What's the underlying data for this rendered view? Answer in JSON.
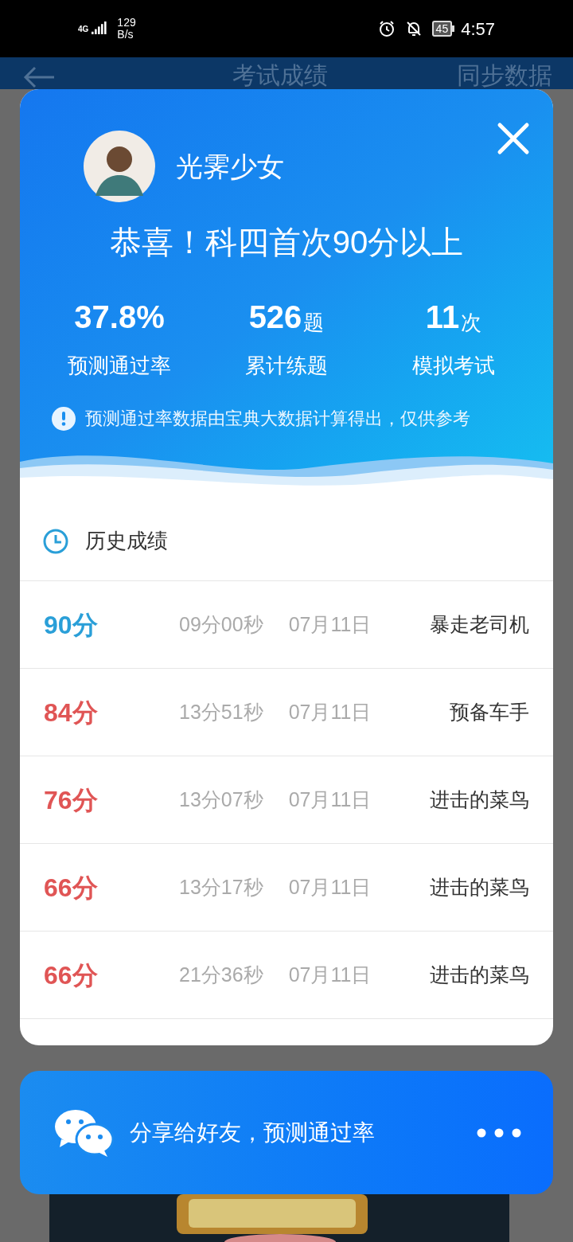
{
  "status_bar": {
    "network": "4G",
    "speed": "129",
    "speed_unit": "B/s",
    "battery": "45",
    "time": "4:57"
  },
  "page": {
    "title": "考试成绩",
    "action": "同步数据"
  },
  "result": {
    "user_name": "光霁少女",
    "headline": "恭喜！科四首次90分以上",
    "stats": [
      {
        "value": "37.8%",
        "label": "预测通过率"
      },
      {
        "value": "526",
        "unit": "题",
        "label": "累计练题"
      },
      {
        "value": "11",
        "unit": "次",
        "label": "模拟考试"
      }
    ],
    "notice": "预测通过率数据由宝典大数据计算得出，仅供参考"
  },
  "history": {
    "title": "历史成绩",
    "rows": [
      {
        "score": "90分",
        "color": "#2a9fd8",
        "duration": "09分00秒",
        "date": "07月11日",
        "rank": "暴走老司机"
      },
      {
        "score": "84分",
        "color": "#e05555",
        "duration": "13分51秒",
        "date": "07月11日",
        "rank": "预备车手"
      },
      {
        "score": "76分",
        "color": "#e05555",
        "duration": "13分07秒",
        "date": "07月11日",
        "rank": "进击的菜鸟"
      },
      {
        "score": "66分",
        "color": "#e05555",
        "duration": "13分17秒",
        "date": "07月11日",
        "rank": "进击的菜鸟"
      },
      {
        "score": "66分",
        "color": "#e05555",
        "duration": "21分36秒",
        "date": "07月11日",
        "rank": "进击的菜鸟"
      }
    ]
  },
  "share": {
    "text": "分享给好友，预测通过率"
  }
}
